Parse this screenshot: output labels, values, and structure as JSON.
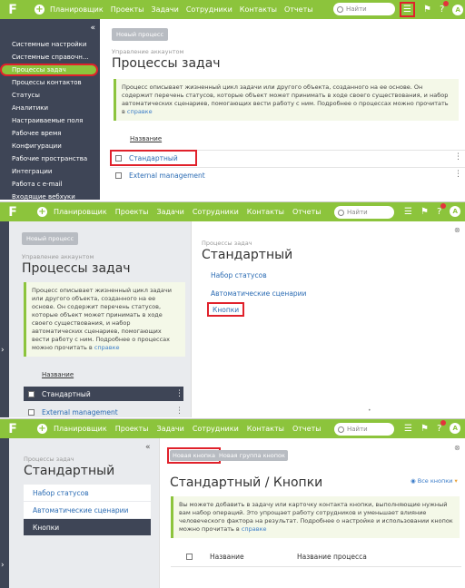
{
  "topbar": {
    "logo": "F",
    "nav": [
      "Планировщик",
      "Проекты",
      "Задачи",
      "Сотрудники",
      "Контакты",
      "Отчеты"
    ],
    "search": "Найти",
    "avatar": "A"
  },
  "sidebar": {
    "collapse": "«",
    "items": [
      "Системные настройки",
      "Системные справочн...",
      "Процессы задач",
      "Процессы контактов",
      "Статусы",
      "Аналитики",
      "Настраиваемые поля",
      "Рабочее время",
      "Конфигурации",
      "Рабочие пространства",
      "Интеграции",
      "Работа с e-mail",
      "Входящие вебхуки"
    ]
  },
  "p1": {
    "new_process": "Новый процесс",
    "sub": "Управление аккаунтом",
    "title": "Процессы задач",
    "info": "Процесс описывает жизненный цикл задачи или другого объекта, созданного на ее основе. Он содержит перечень статусов, которые объект может принимать в ходе своего существования, и набор автоматических сценариев, помогающих вести работу с ним. Подробнее о процессах можно прочитать в",
    "info_link": "справке",
    "column": "Название",
    "rows": [
      "Стандартный",
      "External management"
    ]
  },
  "p2": {
    "new_process": "Новый процесс",
    "sub": "Управление аккаунтом",
    "title": "Процессы задач",
    "info": "Процесс описывает жизненный цикл задачи или другого объекта, созданного на ее основе. Он содержит перечень статусов, которые объект может принимать в ходе своего существования, и набор автоматических сценариев, помогающих вести работу с ним. Подробнее о процессах можно прочитать в",
    "info_link": "справке",
    "column": "Название",
    "rows": [
      "Стандартный",
      "External management"
    ],
    "right_sub": "Процессы задач",
    "right_title": "Стандартный",
    "links": [
      "Набор статусов",
      "Автоматические сценарии",
      "Кнопки"
    ]
  },
  "p3": {
    "collapse": "«",
    "sub": "Процессы задач",
    "title": "Стандартный",
    "links": [
      "Набор статусов",
      "Автоматические сценарии",
      "Кнопки"
    ],
    "btn_new": "Новая кнопка",
    "btn_group": "Новая группа кнопок",
    "title2": "Стандартный / Кнопки",
    "all_buttons": "Все кнопки",
    "info": "Вы можете добавить в задачу или карточку контакта кнопки, выполняющие нужный вам набор операций. Это упрощает работу сотрудников и уменьшает влияние человеческого фактора на результат. Подробнее о настройке и использовании кнопок можно прочитать в",
    "info_link": "справке",
    "col1": "Название",
    "col2": "Название процесса"
  }
}
